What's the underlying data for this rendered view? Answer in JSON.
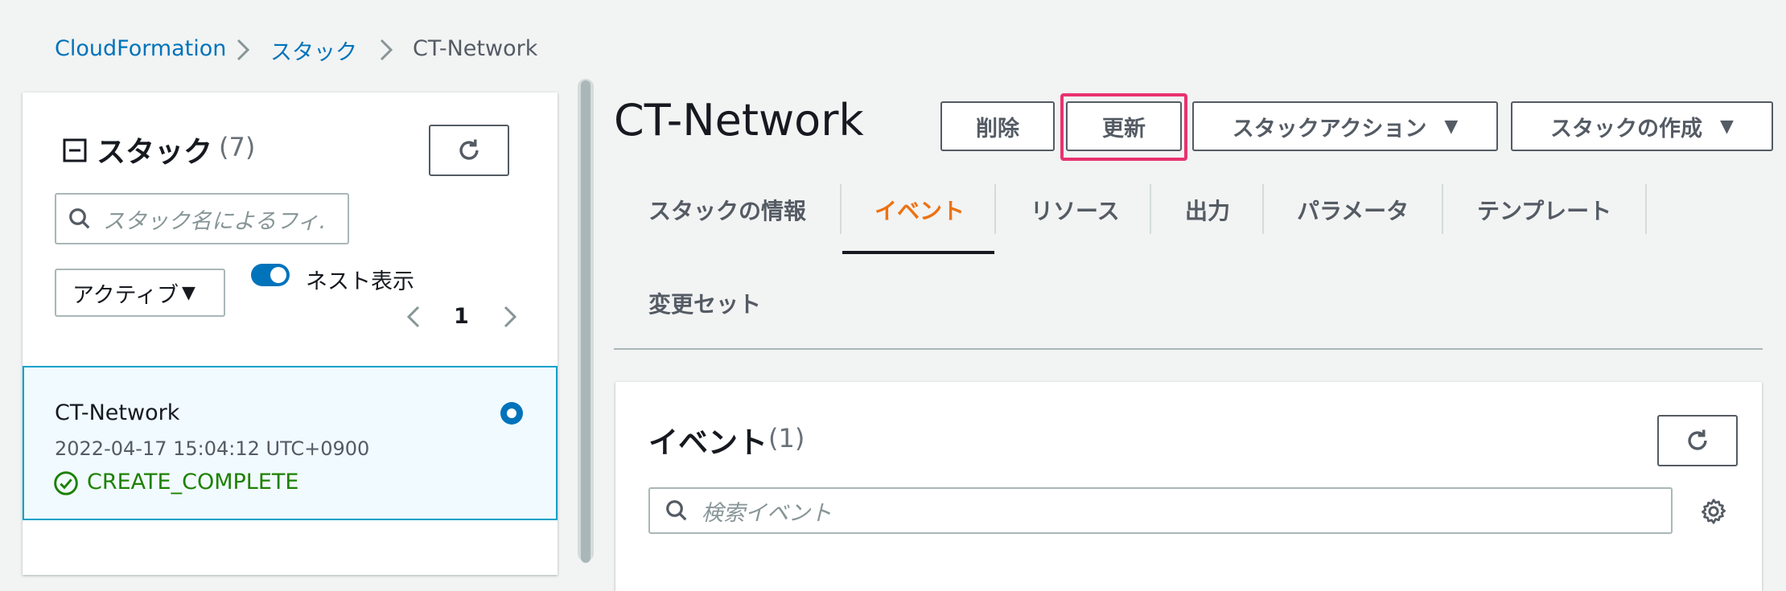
{
  "breadcrumb": {
    "items": [
      {
        "label": "CloudFormation"
      },
      {
        "label": "スタック"
      }
    ],
    "current": "CT-Network"
  },
  "sidebar": {
    "title": "スタック",
    "count": "(7)",
    "search": {
      "placeholder": "スタック名によるフィ."
    },
    "filter": {
      "value": "アクティブ"
    },
    "nested_toggle": {
      "label": "ネスト表示",
      "on": true
    },
    "pagination": {
      "page": "1"
    },
    "stacks": [
      {
        "name": "CT-Network",
        "timestamp": "2022-04-17 15:04:12 UTC+0900",
        "status": "CREATE_COMPLETE",
        "selected": true
      }
    ]
  },
  "main": {
    "title": "CT-Network",
    "buttons": {
      "delete": "削除",
      "update": "更新",
      "stack_actions": "スタックアクション",
      "create_stack": "スタックの作成"
    },
    "highlight_color": "#e8336e",
    "tabs": [
      {
        "label": "スタックの情報",
        "active": false
      },
      {
        "label": "イベント",
        "active": true
      },
      {
        "label": "リソース",
        "active": false
      },
      {
        "label": "出力",
        "active": false
      },
      {
        "label": "パラメータ",
        "active": false
      },
      {
        "label": "テンプレート",
        "active": false
      },
      {
        "label": "変更セット",
        "active": false
      }
    ],
    "events": {
      "title": "イベント",
      "count": "(1)",
      "search": {
        "placeholder": "検索イベント"
      }
    }
  },
  "colors": {
    "link": "#0073bb",
    "active_tab": "#ec7211",
    "success": "#1d8102",
    "accent": "#0073bb"
  }
}
